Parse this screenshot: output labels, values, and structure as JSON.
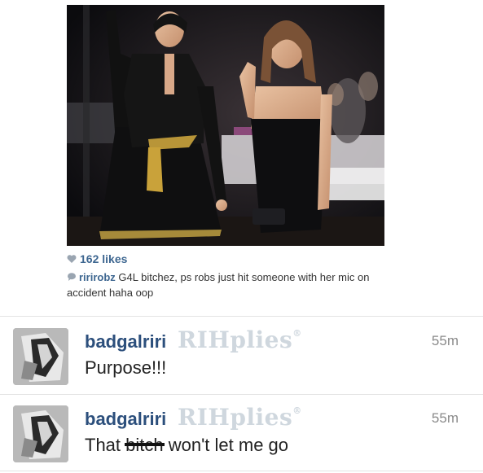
{
  "post": {
    "likes": "162 likes",
    "caption_user": "ririrobz",
    "caption_text": " G4L bitchez, ps robs just hit someone with her mic on accident haha oop"
  },
  "tweets": [
    {
      "name": "badgalriri",
      "source": "RIHplies",
      "source_mark": "®",
      "time": "55m",
      "text": "Purpose!!!"
    },
    {
      "name": "badgalriri",
      "source": "RIHplies",
      "source_mark": "®",
      "time": "55m",
      "text_before": "That ",
      "text_censored": "bitch",
      "text_after": " won't let me go"
    }
  ],
  "icons": {
    "likes": "heart-icon",
    "caption": "comment-bubble-icon"
  },
  "colors": {
    "username_blue": "#3d6690",
    "tweet_name_blue": "#2c4f7c",
    "watermark_gray": "#cfd7de",
    "time_gray": "#8a8a8a"
  }
}
